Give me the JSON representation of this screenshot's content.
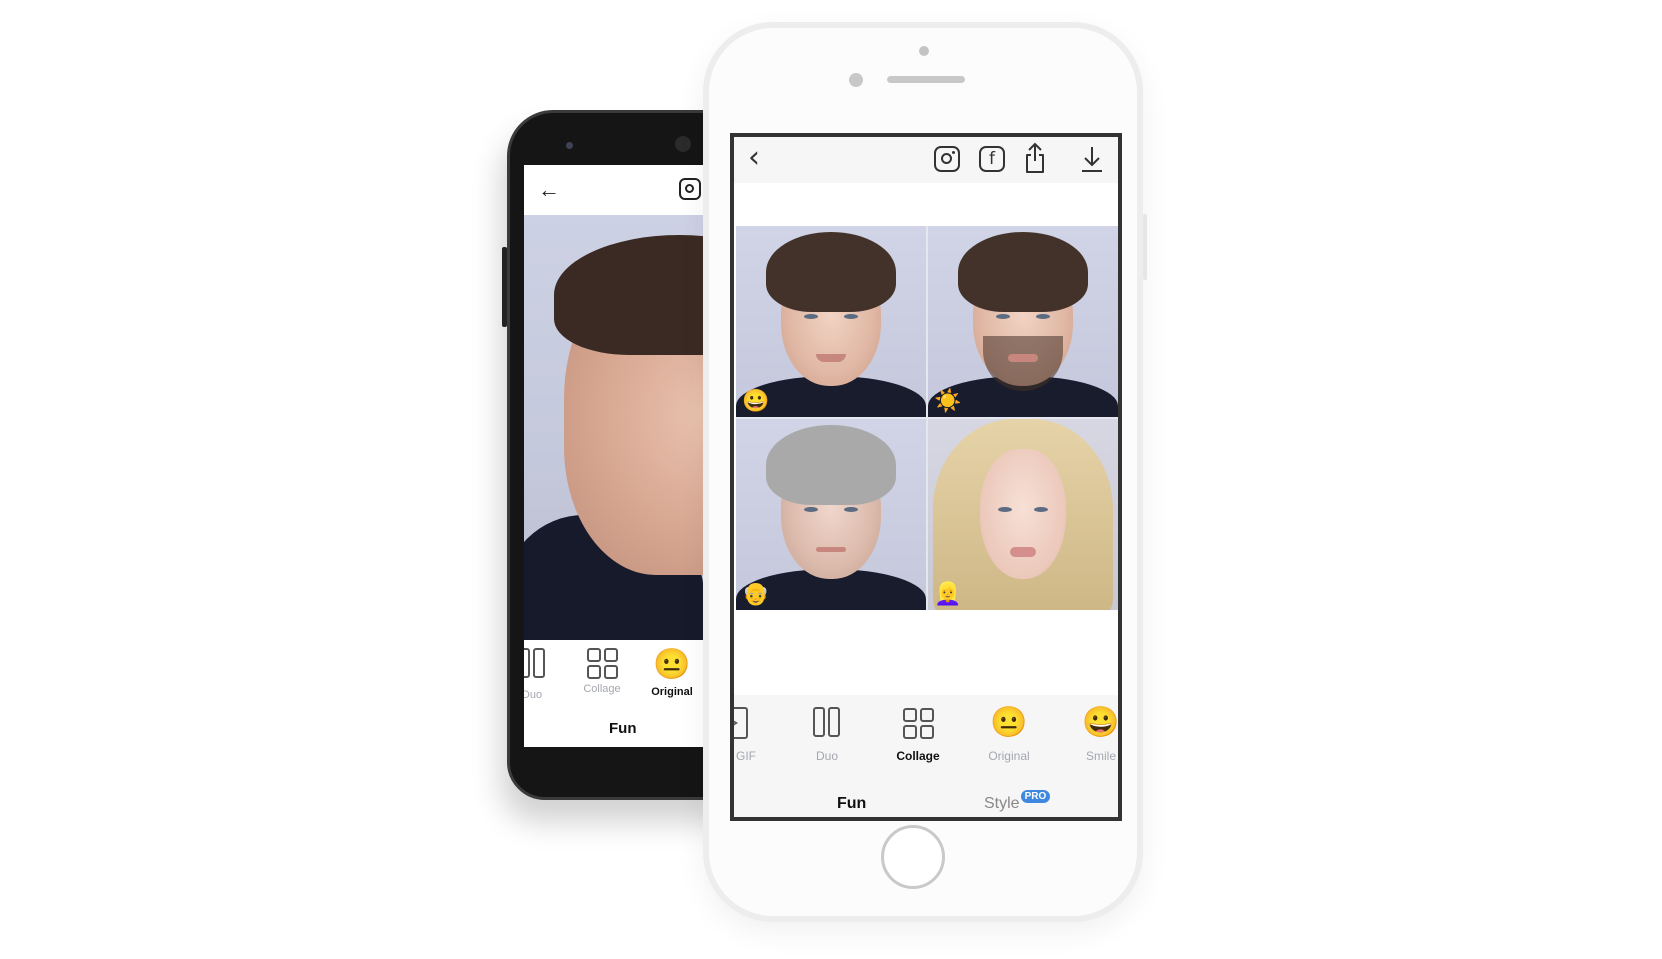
{
  "android": {
    "header": {
      "back_icon": "arrow-left-icon",
      "share_icon": "instagram-icon"
    },
    "toolbar": [
      {
        "label": "Duo",
        "icon": "duo-icon",
        "active": false
      },
      {
        "label": "Collage",
        "icon": "collage-icon",
        "active": false
      },
      {
        "label": "Original",
        "icon": "neutral-face-emoji",
        "emoji": "😐",
        "active": true
      }
    ],
    "tab": "Fun"
  },
  "iphone": {
    "header": {
      "back_icon": "chevron-left-icon",
      "back_glyph": "‹",
      "facebook_glyph": "f",
      "icons": [
        "instagram-icon",
        "facebook-icon",
        "share-icon",
        "download-icon"
      ]
    },
    "collage": [
      {
        "variant": "smile",
        "badge": "😀"
      },
      {
        "variant": "hipster",
        "badge": "☀️"
      },
      {
        "variant": "old",
        "badge": "👴"
      },
      {
        "variant": "female",
        "badge": "👱‍♀️"
      }
    ],
    "toolbar": [
      {
        "label": "GIF",
        "icon": "gif-icon",
        "active": false
      },
      {
        "label": "Duo",
        "icon": "duo-icon",
        "active": false
      },
      {
        "label": "Collage",
        "icon": "collage-icon",
        "active": true
      },
      {
        "label": "Original",
        "icon": "neutral-face-emoji",
        "emoji": "😐",
        "active": false
      },
      {
        "label": "Smile",
        "icon": "smile-emoji",
        "emoji": "😀",
        "active": false
      }
    ],
    "tabs": [
      {
        "label": "Fun",
        "active": true
      },
      {
        "label": "Style",
        "active": false,
        "badge": "PRO"
      }
    ],
    "colors": {
      "pro_badge": "#3f88e0",
      "active_text": "#111111",
      "inactive_text": "#a4a7b0"
    }
  }
}
